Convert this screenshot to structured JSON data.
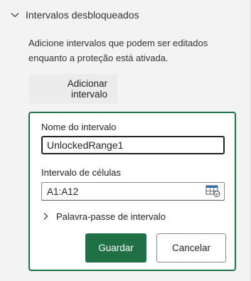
{
  "section": {
    "title": "Intervalos desbloqueados",
    "description": "Adicione intervalos que podem ser editados enquanto a proteção está ativada.",
    "add_button_label": "Adicionar intervalo"
  },
  "form": {
    "name_label": "Nome do intervalo",
    "name_value": "UnlockedRange1",
    "cells_label": "Intervalo de células",
    "cells_value": "A1:A12",
    "range_picker_icon": "range-select-icon",
    "password_toggle_label": "Palavra-passe de intervalo",
    "save_label": "Guardar",
    "cancel_label": "Cancelar"
  },
  "colors": {
    "accent": "#1f7145",
    "panel_bg": "#f3f3f3"
  }
}
